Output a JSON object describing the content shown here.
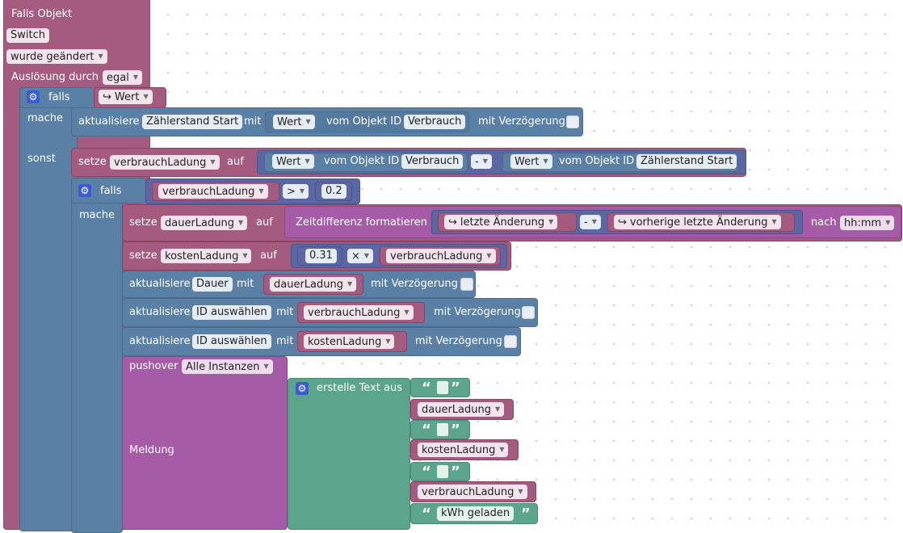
{
  "event": {
    "title": "Falls Objekt",
    "object": "Switch",
    "condition": "wurde geändert",
    "trigger_label": "Auslösung durch",
    "trigger_value": "egal"
  },
  "if1": {
    "falls": "falls",
    "mache": "mache",
    "sonst": "sonst",
    "cond_value": "Wert"
  },
  "update1": {
    "label": "aktualisiere",
    "target": "Zählerstand Start",
    "mit": "mit",
    "value_field": "Wert",
    "vom_objekt": "vom Objekt ID",
    "object_id": "Verbrauch",
    "delay_label": "mit Verzögerung"
  },
  "set1": {
    "setze": "setze",
    "variable": "verbrauchLadung",
    "auf": "auf",
    "left_field": "Wert",
    "left_vom": "vom Objekt ID",
    "left_id": "Verbrauch",
    "operator": "-",
    "right_field": "Wert",
    "right_vom": "vom Objekt ID",
    "right_id": "Zählerstand Start"
  },
  "if2": {
    "falls": "falls",
    "mache": "mache",
    "cond_var": "verbrauchLadung",
    "operator": ">",
    "threshold": "0.2"
  },
  "set2": {
    "setze": "setze",
    "variable": "dauerLadung",
    "auf": "auf",
    "func": "Zeitdifferenz formatieren",
    "a": "letzte Änderung",
    "operator": "-",
    "b": "vorherige letzte Änderung",
    "nach": "nach",
    "format": "hh:mm"
  },
  "set3": {
    "setze": "setze",
    "variable": "kostenLadung",
    "auf": "auf",
    "factor": "0.31",
    "operator": "×",
    "operand": "verbrauchLadung"
  },
  "update2": {
    "label": "aktualisiere",
    "target": "Dauer",
    "mit": "mit",
    "value": "dauerLadung",
    "delay_label": "mit Verzögerung"
  },
  "update3": {
    "label": "aktualisiere",
    "target": "ID auswählen",
    "mit": "mit",
    "value": "verbrauchLadung",
    "delay_label": "mit Verzögerung"
  },
  "update4": {
    "label": "aktualisiere",
    "target": "ID auswählen",
    "mit": "mit",
    "value": "kostenLadung",
    "delay_label": "mit Verzögerung"
  },
  "pushover": {
    "label": "pushover",
    "instance": "Alle Instanzen",
    "message_label": "Meldung",
    "text_join": "erstelle Text aus",
    "item_var1": "dauerLadung",
    "item_var2": "kostenLadung",
    "item_var3": "verbrauchLadung",
    "item_text": "kWh geladen"
  },
  "icons": {
    "gear": "gear-icon",
    "return": "return-arrow-icon",
    "dropdown": "dropdown-arrow-icon"
  },
  "colors": {
    "event": "#a55b80",
    "control": "#5b80a5",
    "variable": "#a55b80",
    "text": "#5ba58c",
    "date": "#a55ba5",
    "math": "#5b67a5"
  }
}
